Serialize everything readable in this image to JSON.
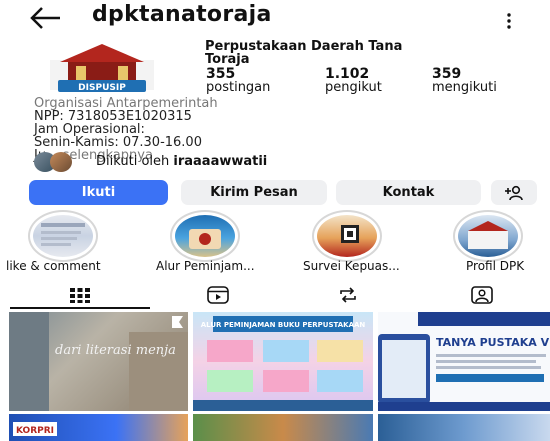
{
  "header": {
    "username": "dpktanatoraja"
  },
  "profile": {
    "avatar_text": "DISPUSIP",
    "name_line1": "Perpustakaan Daerah Tana",
    "name_line2": "Toraja",
    "stats": {
      "posts": {
        "value": "355",
        "label": "postingan"
      },
      "followers": {
        "value": "1.102",
        "label": "pengikut"
      },
      "following": {
        "value": "359",
        "label": "mengikuti"
      }
    },
    "bio": {
      "category": "Organisasi Antarpemerintah",
      "line1": "NPP: 7318053E1020315",
      "line2": "Jam Operasional:",
      "line3": "Senin-Kamis: 07.30-16.00",
      "line4_prefix": "Ju...",
      "more": "selengkapnya"
    },
    "followed_by": {
      "prefix": "Diikuti oleh",
      "user": "iraaaawwatii"
    }
  },
  "actions": {
    "follow": "Ikuti",
    "message": "Kirim Pesan",
    "contact": "Kontak"
  },
  "highlights": [
    {
      "label": "like & comment"
    },
    {
      "label": "Alur Peminjam..."
    },
    {
      "label": "Survei Kepuas..."
    },
    {
      "label": "Profil DPK"
    }
  ],
  "posts": [
    {
      "text": "dari literasi menja"
    },
    {
      "text": "ALUR PEMINJAMAN BUKU PERPUSTAKAAN"
    },
    {
      "text": "TANYA PUSTAKA VIRTUAL"
    },
    {
      "text": "KORPRI"
    }
  ],
  "icons": {
    "back": "arrow-left-icon",
    "more": "more-vertical-icon",
    "add_person": "add-person-icon",
    "grid": "grid-icon",
    "reels": "reels-icon",
    "reposts": "repost-icon",
    "tagged": "tagged-icon"
  },
  "colors": {
    "primary": "#3b72f5",
    "button_bg": "#eff0f2"
  }
}
